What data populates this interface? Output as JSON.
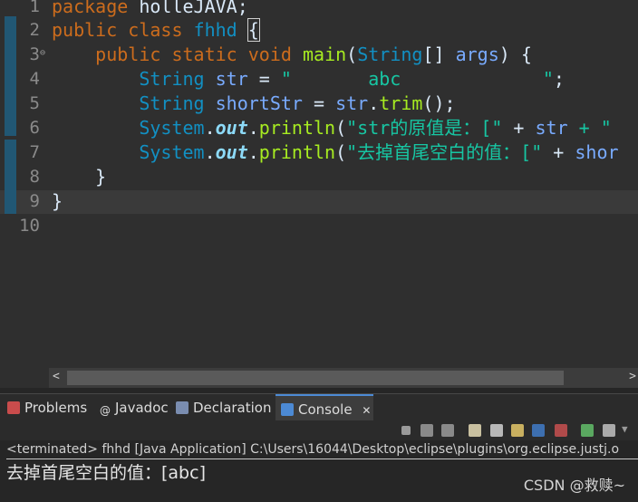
{
  "editor": {
    "line_numbers": [
      "1",
      "2",
      "3",
      "4",
      "5",
      "6",
      "7",
      "8",
      "9",
      "10"
    ],
    "lines": {
      "l1": {
        "kw": "package",
        "name": " holleJAVA;"
      },
      "l2": {
        "kw1": "public",
        "kw2": "class",
        "cls": "fhhd",
        "brace": "{"
      },
      "l3": {
        "kw1": "public",
        "kw2": "static",
        "kw3": "void",
        "fn": "main",
        "p1": "(",
        "ty": "String",
        "p2": "[] ",
        "arg": "args",
        "p3": ") {"
      },
      "l4": {
        "ty": "String",
        "var": "str",
        "eq": " = ",
        "str": "\"       abc             \"",
        "end": ";"
      },
      "l5": {
        "ty": "String",
        "var": "shortStr",
        "eq": " = ",
        "obj": "str",
        "dot": ".",
        "fn": "trim",
        "end": "();"
      },
      "l6": {
        "sys": "System",
        "dot1": ".",
        "fld": "out",
        "dot2": ".",
        "fn": "println",
        "p": "(",
        "str": "\"str的原值是：[\"",
        "plus": " + ",
        "var": "str",
        "rest": " + \""
      },
      "l7": {
        "sys": "System",
        "dot1": ".",
        "fld": "out",
        "dot2": ".",
        "fn": "println",
        "p": "(",
        "str": "\"去掉首尾空白的值：[\"",
        "plus": " + ",
        "var": "shor"
      },
      "l8": {
        "brace": "}"
      },
      "l9": {
        "brace": "}"
      }
    }
  },
  "tabs": [
    {
      "label": "Problems",
      "icon": "problems-icon"
    },
    {
      "label": "Javadoc",
      "icon": "javadoc-icon"
    },
    {
      "label": "Declaration",
      "icon": "declaration-icon"
    },
    {
      "label": "Console",
      "icon": "console-icon",
      "close": "✕"
    }
  ],
  "console": {
    "terminated": "<terminated> fhhd [Java Application] C:\\Users\\16044\\Desktop\\eclipse\\plugins\\org.eclipse.justj.o",
    "output": "去掉首尾空白的值：[abc]"
  },
  "watermark": "CSDN @救赎~",
  "scroll": {
    "left_arrow": "<",
    "right_arrow": ">"
  },
  "colors": {
    "keyword": "#cc6c1d",
    "type": "#1290c3",
    "string": "#17c6a3",
    "method": "#a7ec21",
    "field": "#8ddaf8",
    "accent": "#4c8ad5"
  }
}
